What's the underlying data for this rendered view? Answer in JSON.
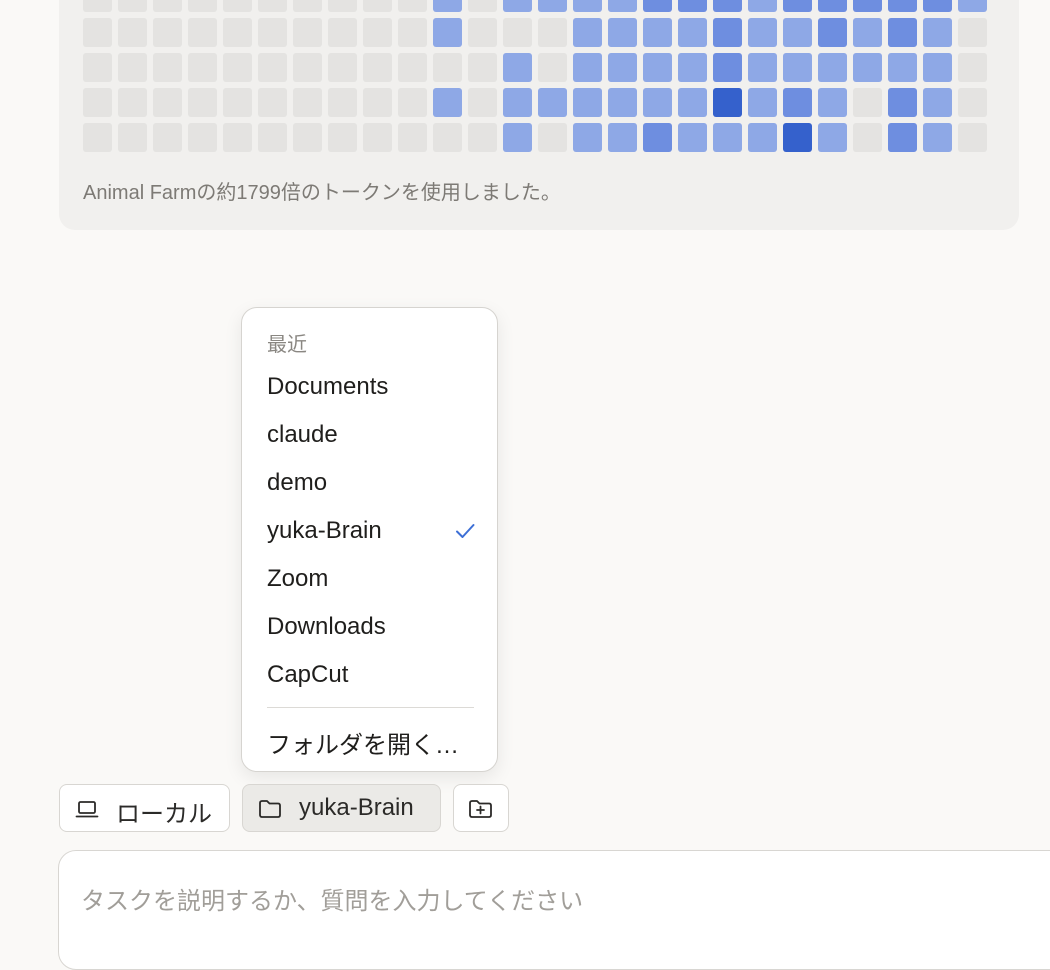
{
  "activity": {
    "caption": "Animal Farmの約1799倍のトークンを使用しました。",
    "legend_colors": {
      "0": "#e4e3e1",
      "1": "#8ea8e6",
      "2": "#6e8ee0",
      "3": "#3561cc"
    },
    "rows": [
      [
        0,
        0,
        0,
        0,
        0,
        0,
        0,
        0,
        0,
        0,
        1,
        0,
        1,
        1,
        1,
        1,
        2,
        2,
        2,
        1,
        2,
        2,
        2,
        2,
        2,
        1
      ],
      [
        0,
        0,
        0,
        0,
        0,
        0,
        0,
        0,
        0,
        0,
        1,
        0,
        0,
        0,
        1,
        1,
        1,
        1,
        2,
        1,
        1,
        2,
        1,
        2,
        1,
        0
      ],
      [
        0,
        0,
        0,
        0,
        0,
        0,
        0,
        0,
        0,
        0,
        0,
        0,
        1,
        0,
        1,
        1,
        1,
        1,
        2,
        1,
        1,
        1,
        1,
        1,
        1,
        0
      ],
      [
        0,
        0,
        0,
        0,
        0,
        0,
        0,
        0,
        0,
        0,
        1,
        0,
        1,
        1,
        1,
        1,
        1,
        1,
        3,
        1,
        2,
        1,
        0,
        2,
        1,
        0
      ],
      [
        0,
        0,
        0,
        0,
        0,
        0,
        0,
        0,
        0,
        0,
        0,
        0,
        1,
        0,
        1,
        1,
        2,
        1,
        1,
        1,
        3,
        1,
        0,
        2,
        1,
        0
      ]
    ]
  },
  "folder_menu": {
    "header": "最近",
    "items": [
      {
        "label": "Documents",
        "selected": false
      },
      {
        "label": "claude",
        "selected": false
      },
      {
        "label": "demo",
        "selected": false
      },
      {
        "label": "yuka-Brain",
        "selected": true
      },
      {
        "label": "Zoom",
        "selected": false
      },
      {
        "label": "Downloads",
        "selected": false
      },
      {
        "label": "CapCut",
        "selected": false
      }
    ],
    "open_folder_label": "フォルダを開く…",
    "accent_color": "#3d6fd6"
  },
  "toolbar": {
    "environment_label": "ローカル",
    "folder_label": "yuka-Brain",
    "add_folder_icon": "folder-plus-icon"
  },
  "prompt": {
    "placeholder": "タスクを説明するか、質問を入力してください"
  }
}
